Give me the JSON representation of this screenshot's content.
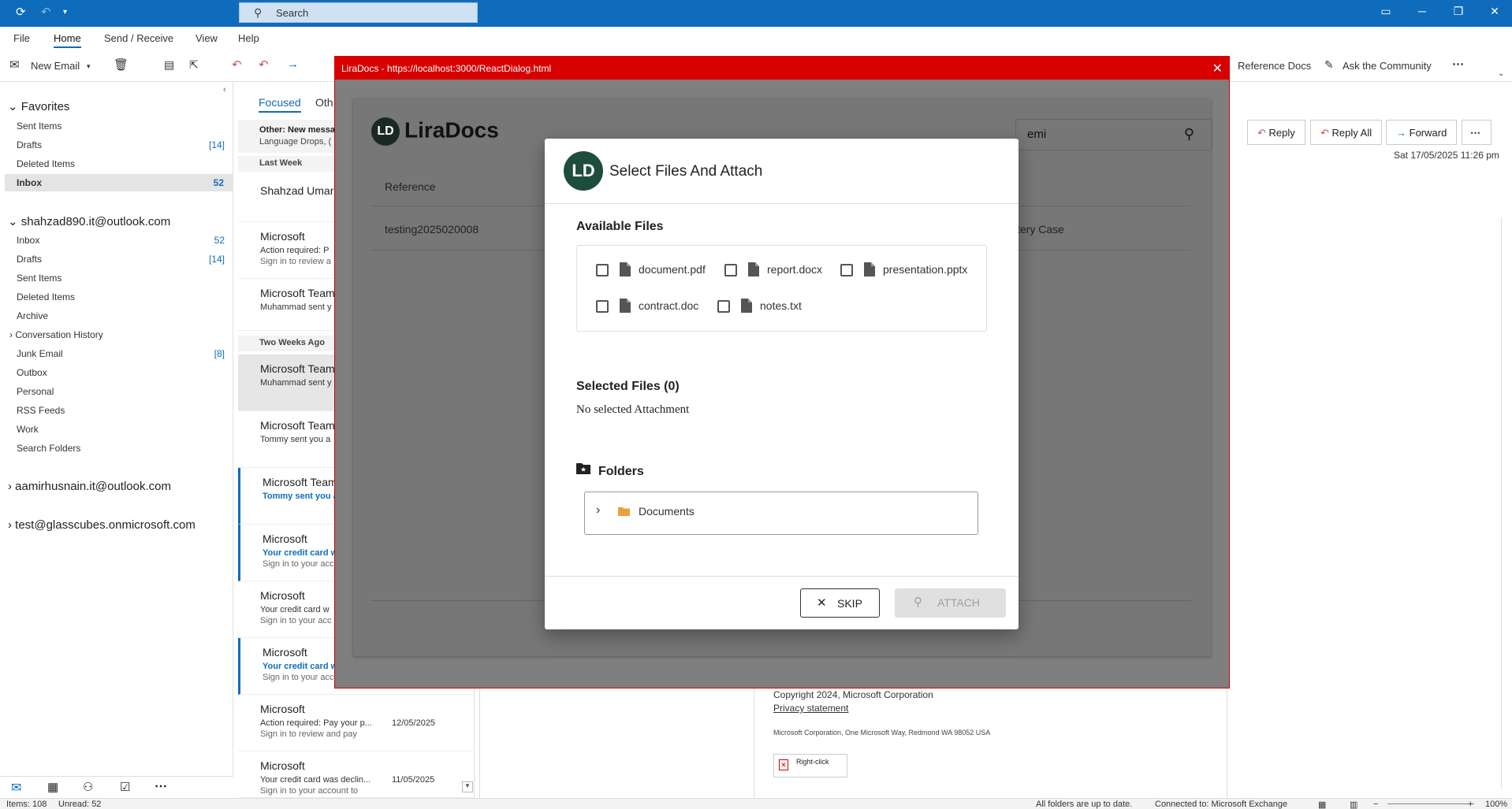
{
  "titlebar": {
    "search_placeholder": "Search"
  },
  "menu": [
    "File",
    "Home",
    "Send / Receive",
    "View",
    "Help"
  ],
  "ribbon": {
    "new_email": "New Email",
    "reference_docs": "Reference Docs",
    "ask_community": "Ask the Community"
  },
  "favorites": {
    "header": "Favorites",
    "items": [
      {
        "label": "Sent Items",
        "count": ""
      },
      {
        "label": "Drafts",
        "count": "[14]"
      },
      {
        "label": "Deleted Items",
        "count": ""
      },
      {
        "label": "Inbox",
        "count": "52"
      }
    ]
  },
  "account1": {
    "header": "shahzad890.it@outlook.com",
    "items": [
      {
        "label": "Inbox",
        "count": "52"
      },
      {
        "label": "Drafts",
        "count": "[14]"
      },
      {
        "label": "Sent Items",
        "count": ""
      },
      {
        "label": "Deleted Items",
        "count": ""
      },
      {
        "label": "Archive",
        "count": ""
      },
      {
        "label": "Conversation History",
        "count": ""
      },
      {
        "label": "Junk Email",
        "count": "[8]"
      },
      {
        "label": "Outbox",
        "count": ""
      },
      {
        "label": "Personal",
        "count": ""
      },
      {
        "label": "RSS Feeds",
        "count": ""
      },
      {
        "label": "Work",
        "count": ""
      },
      {
        "label": "Search Folders",
        "count": ""
      }
    ]
  },
  "account2": "aamirhusnain.it@outlook.com",
  "account3": "test@glasscubes.onmicrosoft.com",
  "msglist": {
    "tab_focused": "Focused",
    "tab_other": "Oth",
    "other_banner_title": "Other: New messa",
    "other_banner_sub": "Language Drops, (",
    "group_last_week": "Last Week",
    "group_two_weeks": "Two Weeks Ago",
    "messages": [
      {
        "sender": "Shahzad Umar",
        "subject": "",
        "preview": "",
        "date": ""
      },
      {
        "sender": "Microsoft",
        "subject": "Action required: P",
        "preview": "Sign in to review a",
        "date": ""
      },
      {
        "sender": "Microsoft Team",
        "subject": "Muhammad sent y",
        "preview": "",
        "date": ""
      },
      {
        "sender": "Microsoft Team",
        "subject": "Muhammad sent y",
        "preview": "",
        "date": ""
      },
      {
        "sender": "Microsoft Team",
        "subject": "Tommy sent you a",
        "preview": "",
        "date": ""
      },
      {
        "sender": "Microsoft Team",
        "subject": "Tommy sent you a",
        "preview": "",
        "date": ""
      },
      {
        "sender": "Microsoft",
        "subject": "Your credit card w",
        "preview": "Sign in to your acc",
        "date": ""
      },
      {
        "sender": "Microsoft",
        "subject": "Your credit card w",
        "preview": "Sign in to your acc",
        "date": ""
      },
      {
        "sender": "Microsoft",
        "subject": "Your credit card w",
        "preview": "Sign in to your acc",
        "date": ""
      },
      {
        "sender": "Microsoft",
        "subject": "Action required: Pay your p...",
        "preview": "Sign in to review and pay",
        "date": "12/05/2025"
      },
      {
        "sender": "Microsoft",
        "subject": "Your credit card was declin...",
        "preview": "Sign in to your account to",
        "date": "11/05/2025"
      }
    ]
  },
  "reading": {
    "reply": "Reply",
    "reply_all": "Reply All",
    "forward": "Forward",
    "date": "Sat 17/05/2025 11:26 pm",
    "copyright": "Copyright 2024, Microsoft Corporation",
    "privacy": "Privacy statement",
    "address": "Microsoft Corporation, One Microsoft Way, Redmond WA 98052 USA",
    "img_placeholder": "Right-click"
  },
  "status": {
    "items": "Items: 108",
    "unread": "Unread: 52",
    "uptodate": "All folders are up to date.",
    "connected": "Connected to: Microsoft Exchange",
    "zoom": "100%"
  },
  "dialog": {
    "title": "LiraDocs - https://localhost:3000/ReactDialog.html",
    "logo_text": "LiraDocs",
    "search_value": "emi",
    "col_reference": "Reference",
    "row_reference": "testing2025020008",
    "row_case": "tery Case"
  },
  "modal": {
    "title": "Select Files And Attach",
    "available_header": "Available Files",
    "files": [
      "document.pdf",
      "report.docx",
      "presentation.pptx",
      "contract.doc",
      "notes.txt"
    ],
    "selected_header": "Selected Files (0)",
    "no_selection": "No selected Attachment",
    "folders_header": "Folders",
    "folder_name": "Documents",
    "skip": "SKIP",
    "attach": "ATTACH"
  },
  "colors": {
    "accent": "#0f6cbd",
    "dialog_title": "#d90000",
    "lira_green": "#1f4d3d"
  }
}
